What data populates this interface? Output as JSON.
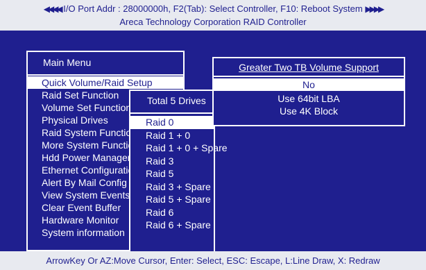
{
  "header": {
    "left_arrows": "◀◀◀◀",
    "status_line": "I/O Port Addr : 28000000h, F2(Tab): Select Controller, F10: Reboot System",
    "right_arrows": "▶▶▶▶",
    "subtitle": "Areca Technology Corporation RAID Controller"
  },
  "main_menu": {
    "title": "Main Menu",
    "items": [
      "Quick Volume/Raid Setup",
      "Raid Set Function",
      "Volume Set Function",
      "Physical Drives",
      "Raid System Function",
      "More System Functions",
      "Hdd Power Management",
      "Ethernet Configuration",
      "Alert By Mail Config",
      "View System Events",
      "Clear Event Buffer",
      "Hardware Monitor",
      "System information"
    ],
    "selected_index": 0
  },
  "drives_panel": {
    "title": "Total 5 Drives",
    "items": [
      "Raid 0",
      "Raid 1 + 0",
      "Raid 1 + 0 + Spare",
      "Raid 3",
      "Raid 5",
      "Raid 3 + Spare",
      "Raid 5 + Spare",
      "Raid 6",
      "Raid 6 + Spare"
    ],
    "selected_index": 0
  },
  "gt_panel": {
    "title": "Greater Two TB Volume Support",
    "items": [
      "No",
      "Use 64bit LBA",
      "Use 4K Block"
    ],
    "selected_index": 0
  },
  "footer": {
    "help_text": "ArrowKey Or AZ:Move Cursor, Enter: Select, ESC: Escape, L:Line Draw, X: Redraw"
  },
  "colors": {
    "background": "#1f1f8f",
    "bar": "#e8eaf0",
    "text": "#ffffff"
  }
}
